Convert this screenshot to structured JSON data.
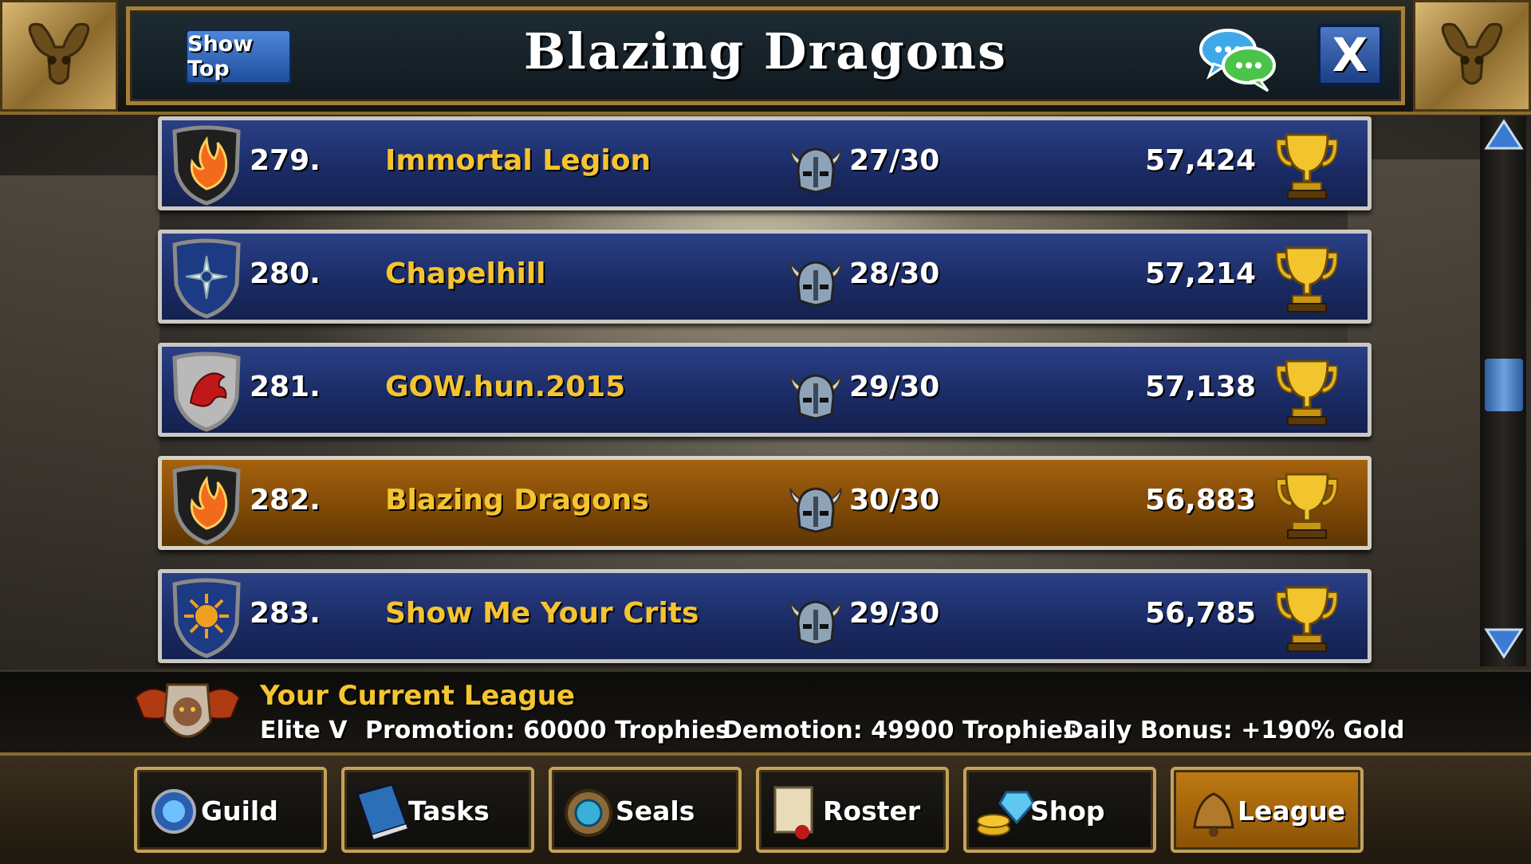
{
  "header": {
    "show_top_label": "Show Top",
    "title": "Blazing Dragons",
    "close_label": "X"
  },
  "guild_list": [
    {
      "rank": "279.",
      "name": "Immortal Legion",
      "members": "27/30",
      "trophies": "57,424",
      "emblem": "phoenix-emblem-icon",
      "shield_color": "#1f1f1f",
      "current": false
    },
    {
      "rank": "280.",
      "name": "Chapelhill",
      "members": "28/30",
      "trophies": "57,214",
      "emblem": "star-emblem-icon",
      "shield_color": "#1d3a84",
      "current": false
    },
    {
      "rank": "281.",
      "name": "GOW.hun.2015",
      "members": "29/30",
      "trophies": "57,138",
      "emblem": "griffin-emblem-icon",
      "shield_color": "#b9b9b9",
      "current": false
    },
    {
      "rank": "282.",
      "name": "Blazing Dragons",
      "members": "30/30",
      "trophies": "56,883",
      "emblem": "phoenix-emblem-icon",
      "shield_color": "#1f1f1f",
      "current": true
    },
    {
      "rank": "283.",
      "name": "Show Me Your Crits",
      "members": "29/30",
      "trophies": "56,785",
      "emblem": "sun-emblem-icon",
      "shield_color": "#1d3a84",
      "current": false
    }
  ],
  "league": {
    "heading": "Your Current League",
    "tier": "Elite V",
    "promotion": "Promotion: 60000 Trophies",
    "demotion": "Demotion: 49900 Trophies",
    "bonus": "Daily Bonus: +190% Gold"
  },
  "nav": [
    {
      "label": "Guild",
      "icon": "guild-orb-icon",
      "active": false
    },
    {
      "label": "Tasks",
      "icon": "book-icon",
      "active": false
    },
    {
      "label": "Seals",
      "icon": "seal-amulet-icon",
      "active": false
    },
    {
      "label": "Roster",
      "icon": "scroll-icon",
      "active": false
    },
    {
      "label": "Shop",
      "icon": "gem-coins-icon",
      "active": false
    },
    {
      "label": "League",
      "icon": "bell-icon",
      "active": true
    }
  ],
  "colors": {
    "row_blue": "#1a2a63",
    "row_current": "#7d4706",
    "guild_name": "#f4c431",
    "frame_gold": "#a47f3c"
  }
}
